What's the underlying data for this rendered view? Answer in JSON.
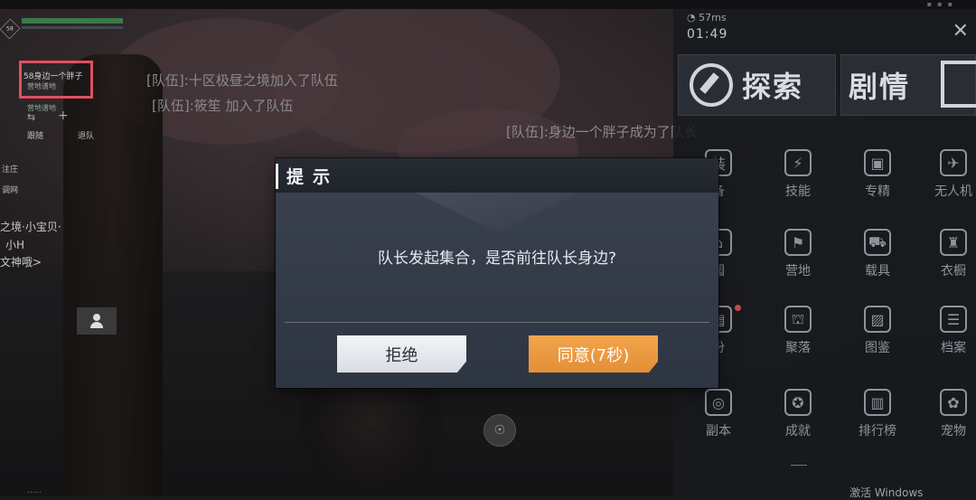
{
  "hud": {
    "level": "58",
    "team_member_name": "58身边一个胖子",
    "team_member_status": "营地谱地",
    "team_member_status2": "营地谱地",
    "side_label_1": "跟随",
    "side_label_2": "退队",
    "side_label_3": "注庄",
    "side_label_4": "调网",
    "left_line_1": "之境·小宝贝·",
    "left_line_2": "小H",
    "left_line_3": "文神哦>"
  },
  "chat": {
    "line1": "[队伍]:十区极昼之境加入了队伍",
    "line2": "[队伍]:筱笙 加入了队伍",
    "line3": "[队伍]:身边一个胖子成为了队长"
  },
  "right_panel": {
    "ping": "57ms",
    "clock": "01:49",
    "tab_explore": "探索",
    "tab_story": "剧情",
    "grid": [
      {
        "label": "备",
        "icon": "装"
      },
      {
        "label": "技能",
        "icon": "⚡"
      },
      {
        "label": "专精",
        "icon": "▣"
      },
      {
        "label": "无人机",
        "icon": "✈"
      },
      {
        "label": "园",
        "icon": "⌂"
      },
      {
        "label": "营地",
        "icon": "⚑"
      },
      {
        "label": "载具",
        "icon": "⛟"
      },
      {
        "label": "衣橱",
        "icon": "♜"
      },
      {
        "label": "份",
        "icon": "▤"
      },
      {
        "label": "聚落",
        "icon": "⛫"
      },
      {
        "label": "图鉴",
        "icon": "▨"
      },
      {
        "label": "档案",
        "icon": "☰"
      },
      {
        "label": "副本",
        "icon": "◎"
      },
      {
        "label": "成就",
        "icon": "✪"
      },
      {
        "label": "排行榜",
        "icon": "▥"
      },
      {
        "label": "宠物",
        "icon": "✿"
      }
    ],
    "watermark": "激活 Windows"
  },
  "dialog": {
    "title": "提示",
    "message": "队长发起集合，是否前往队长身边?",
    "reject_label": "拒绝",
    "agree_label": "同意(7秒)"
  },
  "colors": {
    "agree_button": "#E8953A",
    "reject_button": "#E6E9EE",
    "highlight_box": "#E05060"
  }
}
